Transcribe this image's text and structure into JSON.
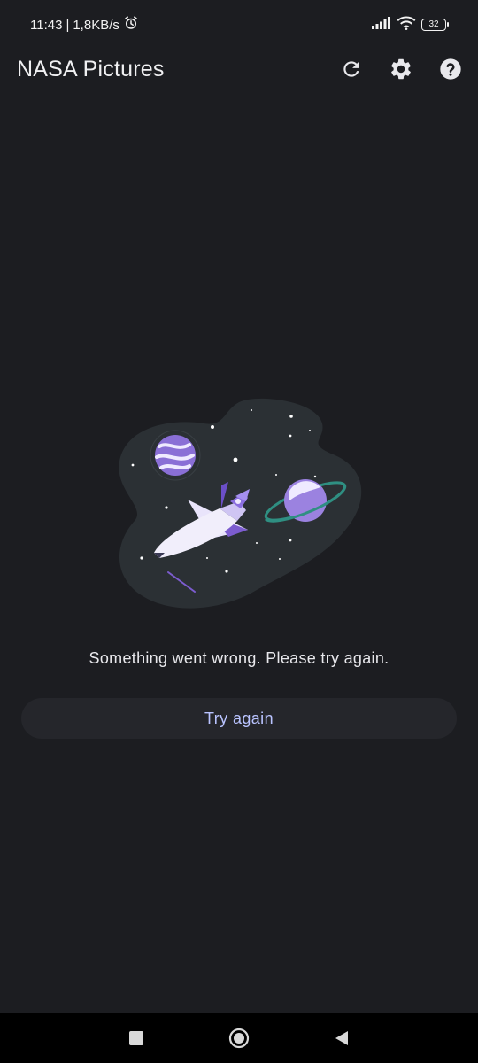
{
  "status_bar": {
    "time": "11:43",
    "separator": "|",
    "network_speed": "1,8KB/s",
    "battery_level": "32"
  },
  "app_bar": {
    "title": "NASA Pictures",
    "icons": [
      "refresh-icon",
      "settings-gear-icon",
      "help-icon"
    ]
  },
  "error": {
    "message": "Something went wrong. Please try again.",
    "retry_label": "Try again"
  },
  "colors": {
    "background": "#1c1d21",
    "accent": "#b9c3ff",
    "button_bg": "#25262b",
    "illustration_blob": "#2b3034",
    "purple": "#7c5ccf"
  },
  "nav_bar": {
    "icons": [
      "recent-apps-icon",
      "home-icon",
      "back-icon"
    ]
  }
}
